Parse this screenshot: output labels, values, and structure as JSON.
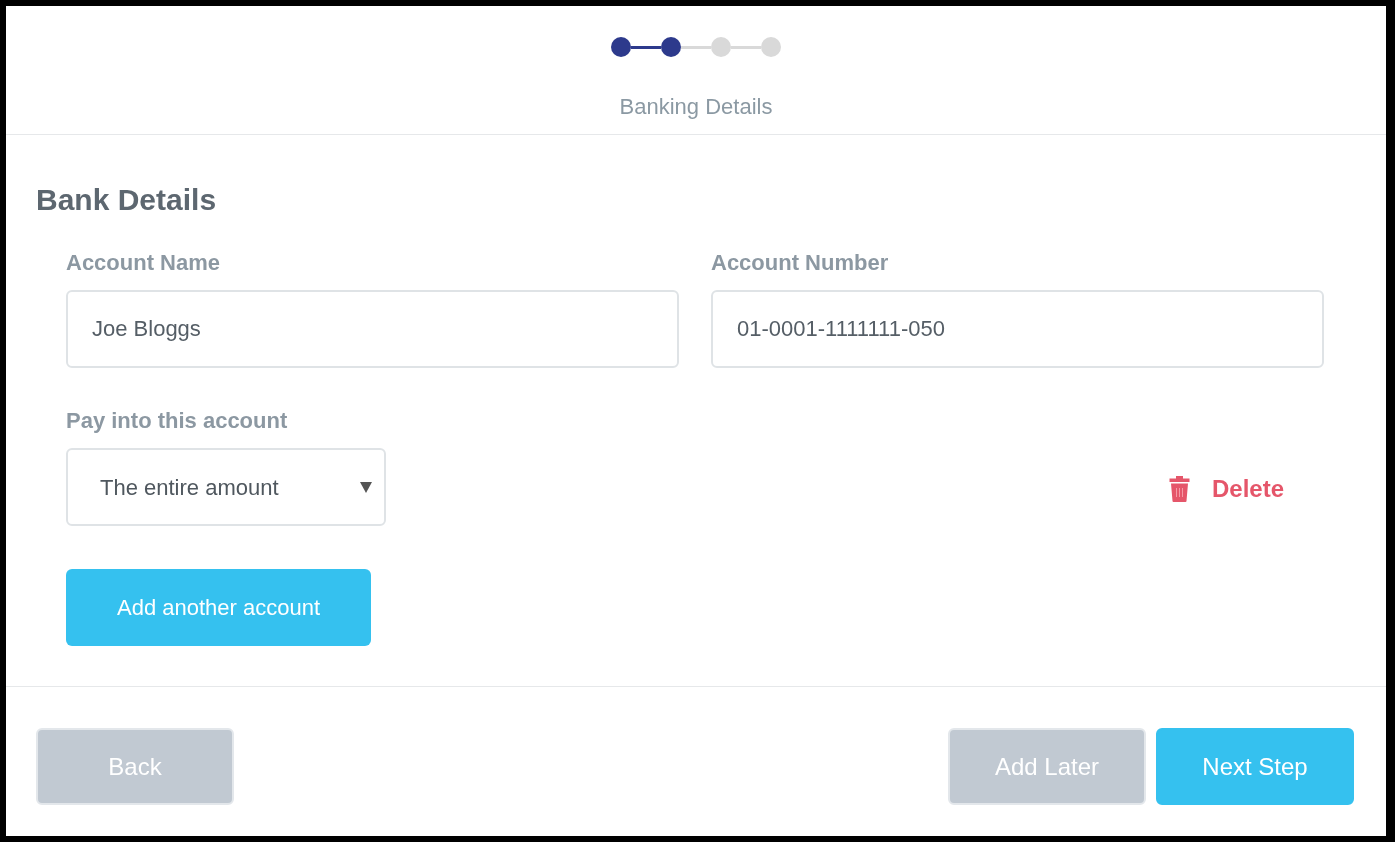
{
  "stepper": {
    "steps": [
      {
        "completed": true
      },
      {
        "completed": true
      },
      {
        "completed": false
      },
      {
        "completed": false
      }
    ],
    "current_label": "Banking Details"
  },
  "section": {
    "title": "Bank Details",
    "fields": [
      {
        "label": "Account Name",
        "value": "Joe Bloggs"
      },
      {
        "label": "Account Number",
        "value": "01-0001-1111111-050"
      }
    ],
    "pay_into": {
      "label": "Pay into this account",
      "value": "The entire amount"
    },
    "delete_button": "Delete",
    "add_button": "Add another account"
  },
  "footer": {
    "buttons": [
      {
        "label": "Back",
        "kind": "secondary"
      },
      {
        "label": "Add Later",
        "kind": "secondary"
      },
      {
        "label": "Next Step",
        "kind": "primary"
      }
    ]
  }
}
